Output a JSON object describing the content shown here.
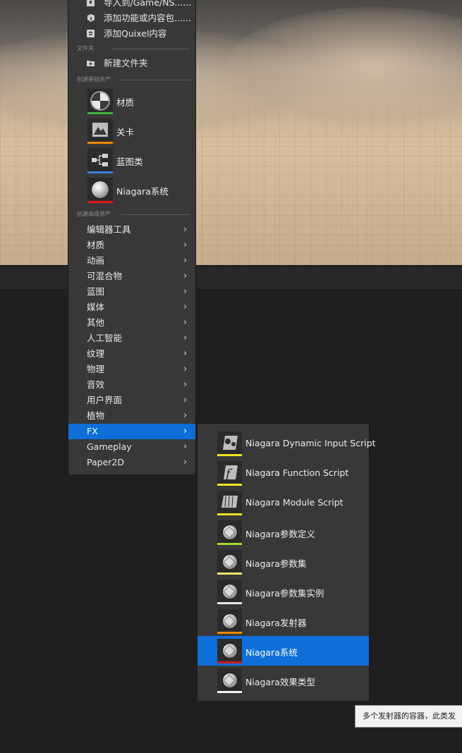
{
  "main_menu": {
    "top_items": [
      {
        "label": "导入到/Game/NS......",
        "icon": "import-icon"
      },
      {
        "label": "添加功能或内容包......",
        "icon": "add-feature-pack-icon"
      },
      {
        "label": "添加Quixel内容",
        "icon": "quixel-icon"
      }
    ],
    "section_folder": "文件夹",
    "new_folder": {
      "label": "新建文件夹",
      "icon": "new-folder-icon"
    },
    "section_basic": "创建基础资产",
    "basic_assets": [
      {
        "label": "材质",
        "icon": "material-icon",
        "color": "#3fb33f"
      },
      {
        "label": "关卡",
        "icon": "level-icon",
        "color": "#f08a00"
      },
      {
        "label": "蓝图类",
        "icon": "blueprint-class-icon",
        "color": "#3d7fe0"
      },
      {
        "label": "Niagara系统",
        "icon": "niagara-system-icon",
        "color": "#e01818"
      }
    ],
    "section_advanced": "创建高级资产",
    "advanced": [
      {
        "label": "编辑器工具"
      },
      {
        "label": "材质"
      },
      {
        "label": "动画"
      },
      {
        "label": "可混合物"
      },
      {
        "label": "蓝图"
      },
      {
        "label": "媒体"
      },
      {
        "label": "其他"
      },
      {
        "label": "人工智能"
      },
      {
        "label": "纹理"
      },
      {
        "label": "物理"
      },
      {
        "label": "音效"
      },
      {
        "label": "用户界面"
      },
      {
        "label": "植物"
      },
      {
        "label": "FX"
      },
      {
        "label": "Gameplay"
      },
      {
        "label": "Paper2D"
      }
    ],
    "active_submenu": "FX"
  },
  "fx_submenu": {
    "items": [
      {
        "label": "Niagara Dynamic Input Script",
        "icon": "dynamic-input-script-icon",
        "color": "#f2e21a"
      },
      {
        "label": "Niagara Function Script",
        "icon": "function-script-icon",
        "color": "#f2e21a"
      },
      {
        "label": "Niagara Module Script",
        "icon": "module-script-icon",
        "color": "#f2e21a"
      },
      {
        "label": "Niagara参数定义",
        "icon": "parameter-definition-icon",
        "color": "#a6d62a"
      },
      {
        "label": "Niagara参数集",
        "icon": "parameter-collection-icon",
        "color": "#f4e86b"
      },
      {
        "label": "Niagara参数集实例",
        "icon": "parameter-collection-instance-icon",
        "color": "#e8e8e8"
      },
      {
        "label": "Niagara发射器",
        "icon": "emitter-icon",
        "color": "#f08a00"
      },
      {
        "label": "Niagara系统",
        "icon": "niagara-system-icon",
        "color": "#c81e1e"
      },
      {
        "label": "Niagara效果类型",
        "icon": "effect-type-icon",
        "color": "#f2f2f2"
      }
    ],
    "active": "Niagara系统"
  },
  "tooltip": {
    "text": "多个发射器的容器，此类发"
  }
}
